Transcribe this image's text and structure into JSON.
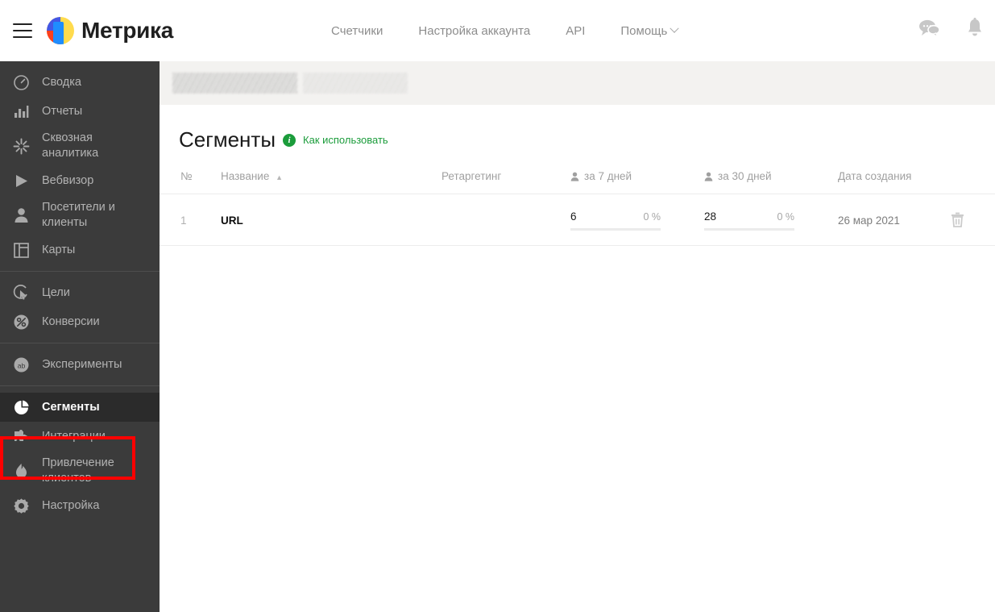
{
  "topbar": {
    "menu_icon": "hamburger-menu-icon",
    "brand": "Метрика",
    "nav": [
      {
        "label": "Счетчики"
      },
      {
        "label": "Настройка аккаунта"
      },
      {
        "label": "API"
      },
      {
        "label": "Помощь",
        "has_chevron": true
      }
    ],
    "icons": [
      {
        "name": "chat-icon"
      },
      {
        "name": "bell-icon"
      }
    ]
  },
  "sidebar": {
    "groups": [
      {
        "items": [
          {
            "label": "Сводка",
            "icon": "dashboard-icon"
          },
          {
            "label": "Отчеты",
            "icon": "bar-chart-icon"
          },
          {
            "label": "Сквозная аналитика",
            "icon": "snowflake-icon"
          },
          {
            "label": "Вебвизор",
            "icon": "play-icon"
          },
          {
            "label": "Посетители и клиенты",
            "icon": "user-icon"
          },
          {
            "label": "Карты",
            "icon": "map-icon"
          }
        ]
      },
      {
        "items": [
          {
            "label": "Цели",
            "icon": "target-cursor-icon"
          },
          {
            "label": "Конверсии",
            "icon": "percent-circle-icon"
          }
        ]
      },
      {
        "items": [
          {
            "label": "Эксперименты",
            "icon": "ab-test-icon"
          }
        ]
      },
      {
        "items": [
          {
            "label": "Сегменты",
            "icon": "pie-chart-icon",
            "active": true,
            "highlighted": true
          },
          {
            "label": "Интеграции",
            "icon": "puzzle-icon"
          },
          {
            "label": "Привлечение клиентов",
            "icon": "flame-icon"
          },
          {
            "label": "Настройка",
            "icon": "gear-icon"
          }
        ]
      }
    ],
    "highlight_color": "#fe0000"
  },
  "main": {
    "banner": {
      "redacted": true
    },
    "page_title": "Сегменты",
    "info_icon": "info-icon",
    "howto_link": "Как использовать",
    "accent_green": "#1b9c3b",
    "table": {
      "columns": [
        {
          "key": "num",
          "label": "№"
        },
        {
          "key": "name",
          "label": "Название",
          "sort": "▲"
        },
        {
          "key": "retargeting",
          "label": "Ретаргетинг"
        },
        {
          "key": "d7",
          "label": "за 7 дней",
          "icon": "user-icon"
        },
        {
          "key": "d30",
          "label": "за 30 дней",
          "icon": "user-icon"
        },
        {
          "key": "date",
          "label": "Дата создания"
        }
      ],
      "rows": [
        {
          "num": "1",
          "name": "URL",
          "retargeting": "",
          "d7_value": "6",
          "d7_percent": "0 %",
          "d7_bar_pct": 0,
          "d30_value": "28",
          "d30_percent": "0 %",
          "d30_bar_pct": 0,
          "date": "26 мар 2021",
          "delete_icon": "trash-icon"
        }
      ]
    }
  }
}
